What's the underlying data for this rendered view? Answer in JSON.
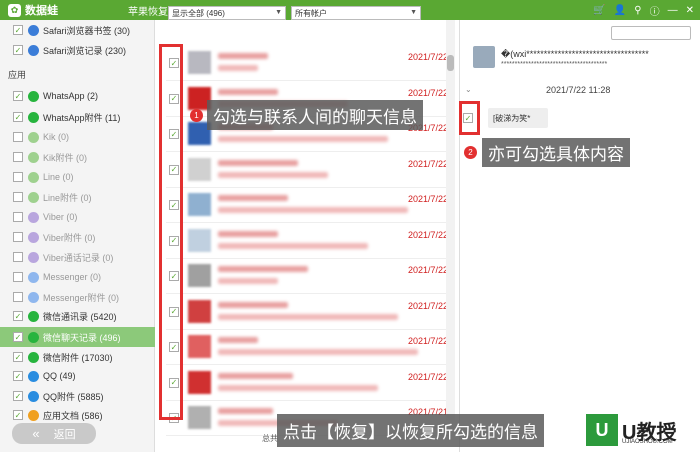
{
  "app": {
    "logo_text": "数据蛙",
    "title": "苹果恢复专家 (未注册)"
  },
  "titlebar_icons": [
    "cart-icon",
    "user-icon",
    "key-icon",
    "info-icon",
    "minimize-icon",
    "close-icon"
  ],
  "sidebar": {
    "section_header": "应用",
    "items": [
      {
        "label": "Safari浏览器书签 (30)",
        "checked": true,
        "dim": false,
        "color": "#3b7dd8"
      },
      {
        "label": "Safari浏览记录 (230)",
        "checked": true,
        "dim": false,
        "color": "#3b7dd8"
      },
      {
        "label": "WhatsApp (2)",
        "checked": true,
        "dim": false,
        "color": "#27b43e"
      },
      {
        "label": "WhatsApp附件 (11)",
        "checked": true,
        "dim": false,
        "color": "#27b43e"
      },
      {
        "label": "Kik (0)",
        "checked": false,
        "dim": true,
        "color": "#9fd18f"
      },
      {
        "label": "Kik附件 (0)",
        "checked": false,
        "dim": true,
        "color": "#9fd18f"
      },
      {
        "label": "Line (0)",
        "checked": false,
        "dim": true,
        "color": "#9fd18f"
      },
      {
        "label": "Line附件 (0)",
        "checked": false,
        "dim": true,
        "color": "#9fd18f"
      },
      {
        "label": "Viber (0)",
        "checked": false,
        "dim": true,
        "color": "#b9a6de"
      },
      {
        "label": "Viber附件 (0)",
        "checked": false,
        "dim": true,
        "color": "#b9a6de"
      },
      {
        "label": "Viber通话记录 (0)",
        "checked": false,
        "dim": true,
        "color": "#b9a6de"
      },
      {
        "label": "Messenger (0)",
        "checked": false,
        "dim": true,
        "color": "#8fb7ee"
      },
      {
        "label": "Messenger附件 (0)",
        "checked": false,
        "dim": true,
        "color": "#8fb7ee"
      },
      {
        "label": "微信通讯录 (5420)",
        "checked": true,
        "dim": false,
        "color": "#27b43e"
      },
      {
        "label": "微信聊天记录 (496)",
        "checked": true,
        "dim": false,
        "color": "#27b43e",
        "selected": true
      },
      {
        "label": "微信附件 (17030)",
        "checked": true,
        "dim": false,
        "color": "#27b43e"
      },
      {
        "label": "QQ (49)",
        "checked": true,
        "dim": false,
        "color": "#2a8de0"
      },
      {
        "label": "QQ附件 (5885)",
        "checked": true,
        "dim": false,
        "color": "#2a8de0"
      },
      {
        "label": "应用文档 (586)",
        "checked": true,
        "dim": false,
        "color": "#f0a020"
      }
    ],
    "back_button": "返回"
  },
  "list": {
    "filter_select": "显示全部 (496)",
    "account_select": "所有帐户",
    "rows": [
      {
        "date": "2021/7/22",
        "thumb": "#b8b8c0",
        "l1": 50,
        "l2": 40
      },
      {
        "date": "2021/7/22",
        "thumb": "#cc2222",
        "l1": 60,
        "l2": 130
      },
      {
        "date": "2021/7/22",
        "thumb": "#3060b0",
        "l1": 55,
        "l2": 170
      },
      {
        "date": "2021/7/22",
        "thumb": "#d0d0d0",
        "l1": 80,
        "l2": 110
      },
      {
        "date": "2021/7/22",
        "thumb": "#8fb0d0",
        "l1": 70,
        "l2": 190
      },
      {
        "date": "2021/7/22",
        "thumb": "#c0d0e0",
        "l1": 60,
        "l2": 150
      },
      {
        "date": "2021/7/22",
        "thumb": "#a0a0a0",
        "l1": 90,
        "l2": 60
      },
      {
        "date": "2021/7/22",
        "thumb": "#d04040",
        "l1": 70,
        "l2": 180
      },
      {
        "date": "2021/7/22",
        "thumb": "#e06060",
        "l1": 40,
        "l2": 200
      },
      {
        "date": "2021/7/22",
        "thumb": "#d03030",
        "l1": 75,
        "l2": 160
      },
      {
        "date": "2021/7/21",
        "thumb": "#b0b0b0",
        "l1": 55,
        "l2": 120
      }
    ],
    "total_text": "总共"
  },
  "detail": {
    "contact_name": "�(wxi***********************************",
    "contact_sub": "***************************************",
    "timestamp": "2021/7/22 11:28",
    "message": "[破涕为笑*"
  },
  "annotations": {
    "step1_num": "1",
    "step1": "勾选与联系人间的聊天信息",
    "step2_num": "2",
    "step2": "亦可勾选具体内容",
    "step3": "点击【恢复】以恢复所勾选的信息"
  },
  "watermark": {
    "title": "U教授",
    "url": "UJIAOSHOU.COM"
  }
}
